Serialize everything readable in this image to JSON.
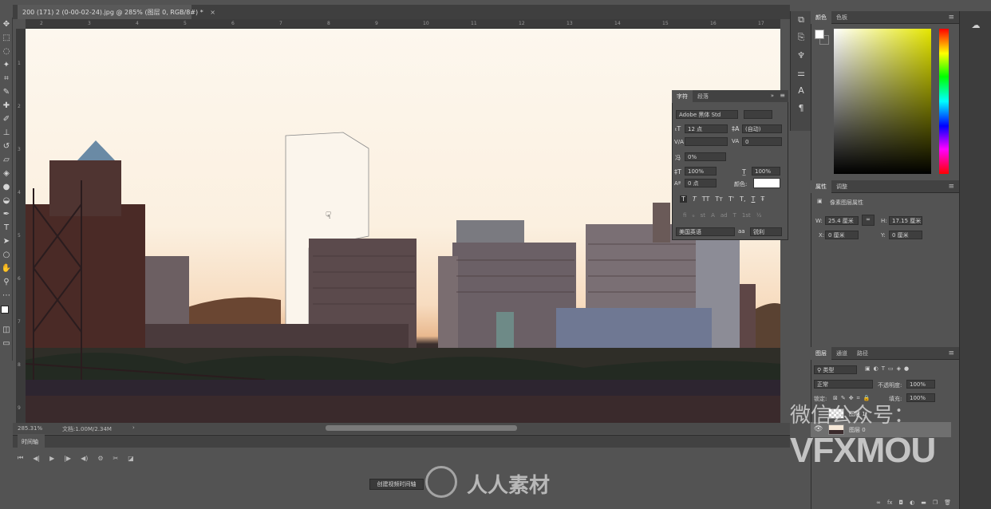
{
  "document": {
    "tab_title": "200 (171) 2 (0-00-02-24).jpg @ 285% (图层 0, RGB/8#) *",
    "close": "×"
  },
  "ruler": {
    "ticks": [
      "2",
      "3",
      "4",
      "5",
      "6",
      "7",
      "8",
      "9",
      "10",
      "11",
      "12",
      "13",
      "14",
      "15",
      "16",
      "17"
    ],
    "vticks": [
      "1",
      "2",
      "3",
      "4",
      "5",
      "6",
      "7",
      "8",
      "9"
    ]
  },
  "status": {
    "zoom": "285.31%",
    "doc_info": "文档:1.00M/2.34M",
    "arrow": "›"
  },
  "timeline": {
    "tab": "时间轴",
    "controls": [
      "⏮",
      "◀|",
      "▶",
      "|▶",
      "◀)",
      "⚙",
      "✂",
      "◪"
    ],
    "create_button": "创建视频时间轴"
  },
  "color_panel": {
    "tabs": [
      "颜色",
      "色板"
    ]
  },
  "properties_panel": {
    "tabs": [
      "属性",
      "调整"
    ],
    "title": "像素图层属性",
    "w_label": "W:",
    "w_value": "25.4 厘米",
    "h_label": "H:",
    "h_value": "17.15 厘米",
    "x_label": "X:",
    "x_value": "0 厘米",
    "y_label": "Y:",
    "y_value": "0 厘米",
    "link_icon": "∞"
  },
  "character_panel": {
    "tabs": [
      "字符",
      "段落"
    ],
    "font": "Adobe 黑体 Std",
    "size": "12 点",
    "leading": "(自动)",
    "kerning_label": "V/A",
    "tracking": "0",
    "scale_pct": "0%",
    "v_scale": "100%",
    "h_scale": "100%",
    "baseline": "0 点",
    "color_label": "颜色:",
    "style_buttons": [
      "T",
      "T",
      "TT",
      "Tт",
      "T'",
      "T,",
      "T",
      "Ŧ"
    ],
    "ot_buttons": [
      "fi",
      "ℴ",
      "st",
      "A",
      "ad",
      "T",
      "1st",
      "½"
    ],
    "language": "美国英语",
    "aa_label": "aa",
    "antialias": "锐利"
  },
  "layers_panel": {
    "tabs": [
      "图层",
      "通道",
      "路径"
    ],
    "filter": "类型",
    "blend_mode": "正常",
    "opacity_label": "不透明度:",
    "opacity": "100%",
    "lock_label": "锁定:",
    "fill_label": "填充:",
    "fill": "100%",
    "layers": [
      {
        "name": "图层 1",
        "visible": false
      },
      {
        "name": "图层 0",
        "visible": true
      }
    ],
    "bottom_icons": [
      "∞",
      "fx",
      "◘",
      "◐",
      "▬",
      "❐",
      "🗑"
    ]
  },
  "watermarks": {
    "wechat": "微信公众号：",
    "brand": "VFXMOU",
    "site": "人人素材"
  },
  "colors": {
    "ui_bg": "#535353",
    "panel_dark": "#424242",
    "hue_accent": "#e5e600"
  },
  "tools": [
    "move-icon",
    "marquee-icon",
    "lasso-icon",
    "magic-wand-icon",
    "crop-icon",
    "eyedropper-icon",
    "healing-icon",
    "brush-icon",
    "stamp-icon",
    "history-brush-icon",
    "eraser-icon",
    "paint-bucket-icon",
    "blur-icon",
    "dodge-icon",
    "pen-icon",
    "type-icon",
    "path-select-icon",
    "ellipse-icon",
    "hand-icon",
    "zoom-icon",
    "more-icon"
  ]
}
